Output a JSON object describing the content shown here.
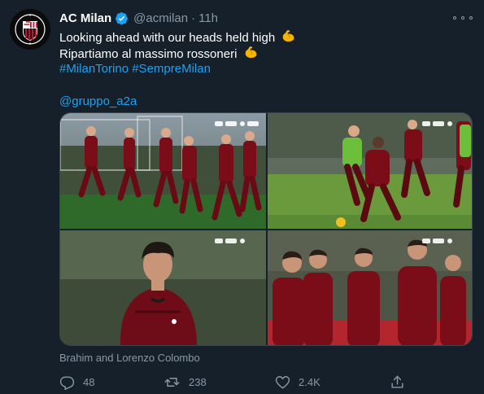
{
  "tweet": {
    "display_name": "AC Milan",
    "handle": "@acmilan",
    "separator": "·",
    "time": "11h",
    "lines": [
      "Looking ahead with our heads held high",
      "Ripartiamo al massimo rossoneri"
    ],
    "hashtags": [
      "#MilanTorino",
      "#SempreMilan"
    ],
    "mention": "@gruppo_a2a",
    "caption": "Brahim and Lorenzo Colombo",
    "counts": {
      "replies": "48",
      "retweets": "238",
      "likes": "2.4K"
    }
  },
  "icons": {
    "verified": "verified-badge-icon",
    "more": "more-horizontal-icon",
    "reply": "reply-icon",
    "retweet": "retweet-icon",
    "like": "heart-icon",
    "share": "share-icon",
    "emoji": "flexed-biceps-emoji"
  },
  "colors": {
    "background": "#15202b",
    "text": "#ffffff",
    "secondary": "#8899a6",
    "link": "#1da1f2",
    "verified": "#1da1f2",
    "milan_red": "#a50b1a"
  }
}
